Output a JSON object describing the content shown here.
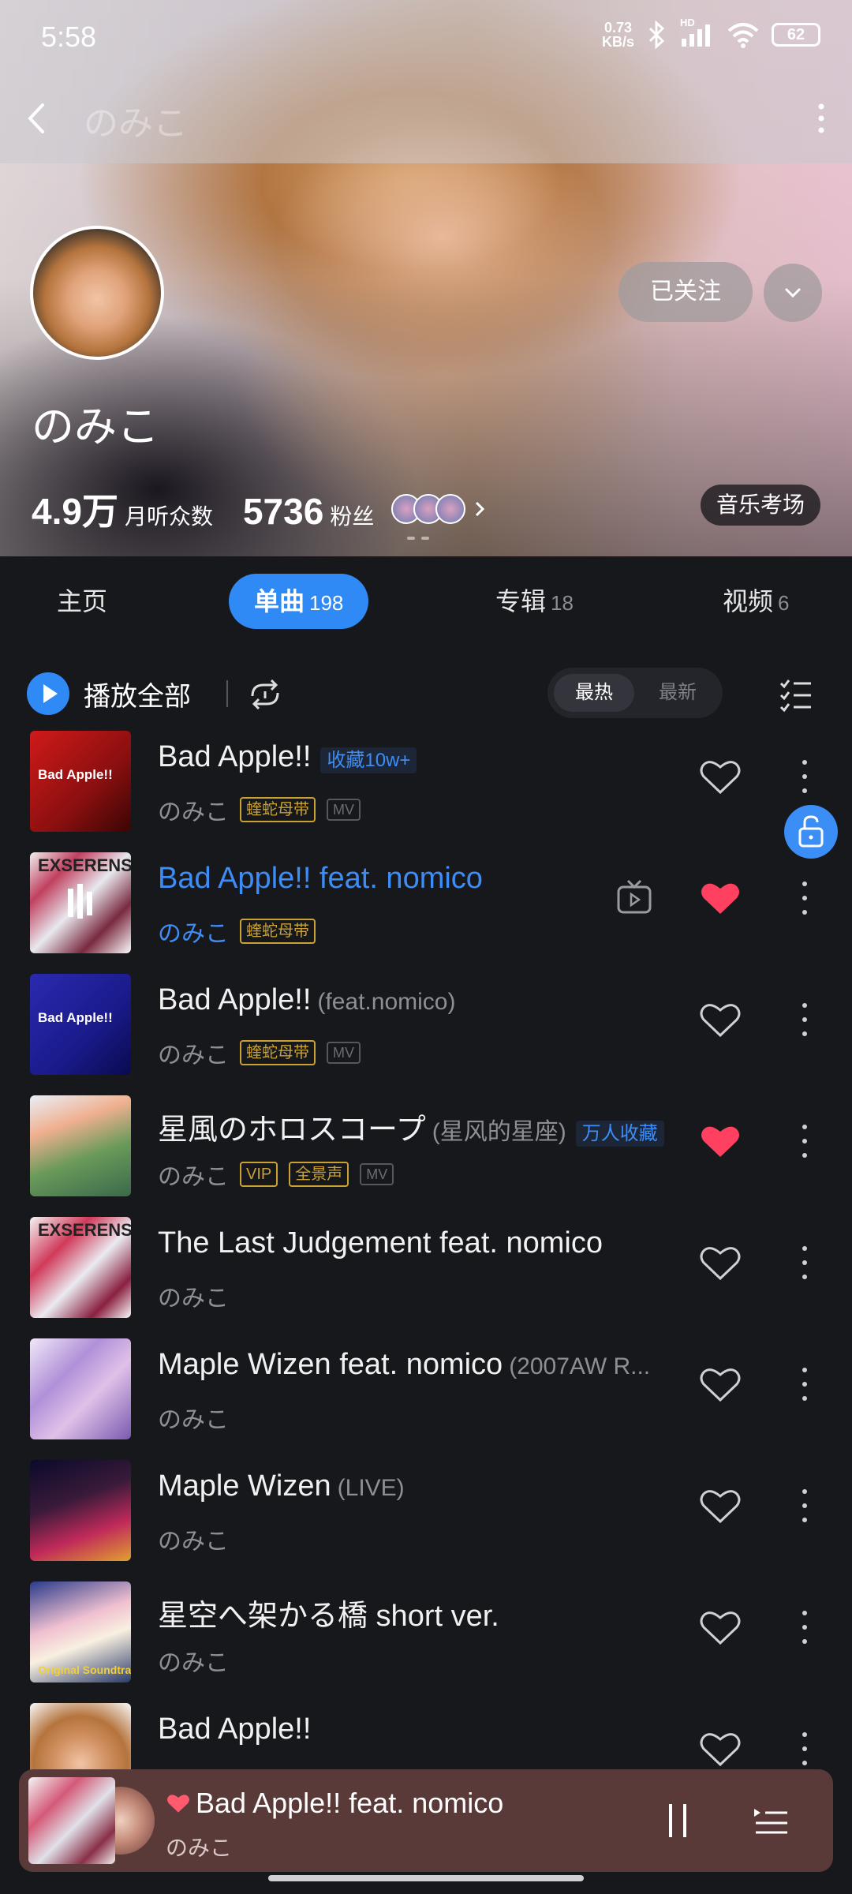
{
  "status": {
    "time": "5:58",
    "net_speed_value": "0.73",
    "net_speed_unit": "KB/s",
    "hd": "HD",
    "battery": "62"
  },
  "header": {
    "title": "のみこ"
  },
  "artist": {
    "name": "のみこ",
    "follow_label": "已关注",
    "listeners_value": "4.9万",
    "listeners_label": "月听众数",
    "fans_value": "5736",
    "fans_label": "粉丝",
    "exam_label": "音乐考场"
  },
  "tabs": [
    {
      "label": "主页",
      "count": ""
    },
    {
      "label": "单曲",
      "count": "198"
    },
    {
      "label": "专辑",
      "count": "18"
    },
    {
      "label": "视频",
      "count": "6"
    }
  ],
  "toolbar": {
    "play_all": "播放全部",
    "sort_hot": "最热",
    "sort_new": "最新"
  },
  "songs": [
    {
      "title": "Bad Apple!!",
      "subtitle": "",
      "tag": "收藏10w+",
      "artist": "のみこ",
      "badge": "蝰蛇母带",
      "mv": "MV",
      "liked": false,
      "playing": false,
      "cover_label": "Bad Apple!!"
    },
    {
      "title": "Bad Apple!! feat. nomico",
      "subtitle": "",
      "tag": "",
      "artist": "のみこ",
      "badge": "蝰蛇母带",
      "mv": "",
      "liked": true,
      "playing": true,
      "cover_label": "EXSERENS"
    },
    {
      "title": "Bad Apple!!",
      "subtitle": "(feat.nomico)",
      "tag": "",
      "artist": "のみこ",
      "badge": "蝰蛇母带",
      "mv": "MV",
      "liked": false,
      "playing": false,
      "cover_label": "Bad Apple!!"
    },
    {
      "title": "星風のホロスコープ",
      "subtitle": "(星风的星座)",
      "tag": "万人收藏",
      "artist": "のみこ",
      "vip": "VIP",
      "badge": "全景声",
      "mv": "MV",
      "liked": true,
      "playing": false,
      "cover_label": ""
    },
    {
      "title": "The Last Judgement feat. nomico",
      "subtitle": "",
      "tag": "",
      "artist": "のみこ",
      "liked": false,
      "playing": false,
      "cover_label": "EXSERENS"
    },
    {
      "title": "Maple Wizen feat. nomico",
      "subtitle": "(2007AW R...",
      "tag": "",
      "artist": "のみこ",
      "liked": false,
      "playing": false,
      "cover_label": ""
    },
    {
      "title": "Maple Wizen",
      "subtitle": "(LIVE)",
      "tag": "",
      "artist": "のみこ",
      "liked": false,
      "playing": false,
      "cover_label": ""
    },
    {
      "title": "星空へ架かる橋 short ver.",
      "subtitle": "",
      "tag": "",
      "artist": "のみこ",
      "liked": false,
      "playing": false,
      "cover_label": "Original Soundtracks"
    },
    {
      "title": "Bad Apple!!",
      "subtitle": "",
      "tag": "",
      "artist": "",
      "liked": false,
      "playing": false,
      "cover_label": ""
    }
  ],
  "mini_player": {
    "title": "Bad Apple!! feat. nomico",
    "artist": "のみこ"
  },
  "colors": {
    "accent": "#2f8af5",
    "liked": "#ff4060",
    "badge_gold": "#c9a233",
    "bg": "#17181c"
  }
}
